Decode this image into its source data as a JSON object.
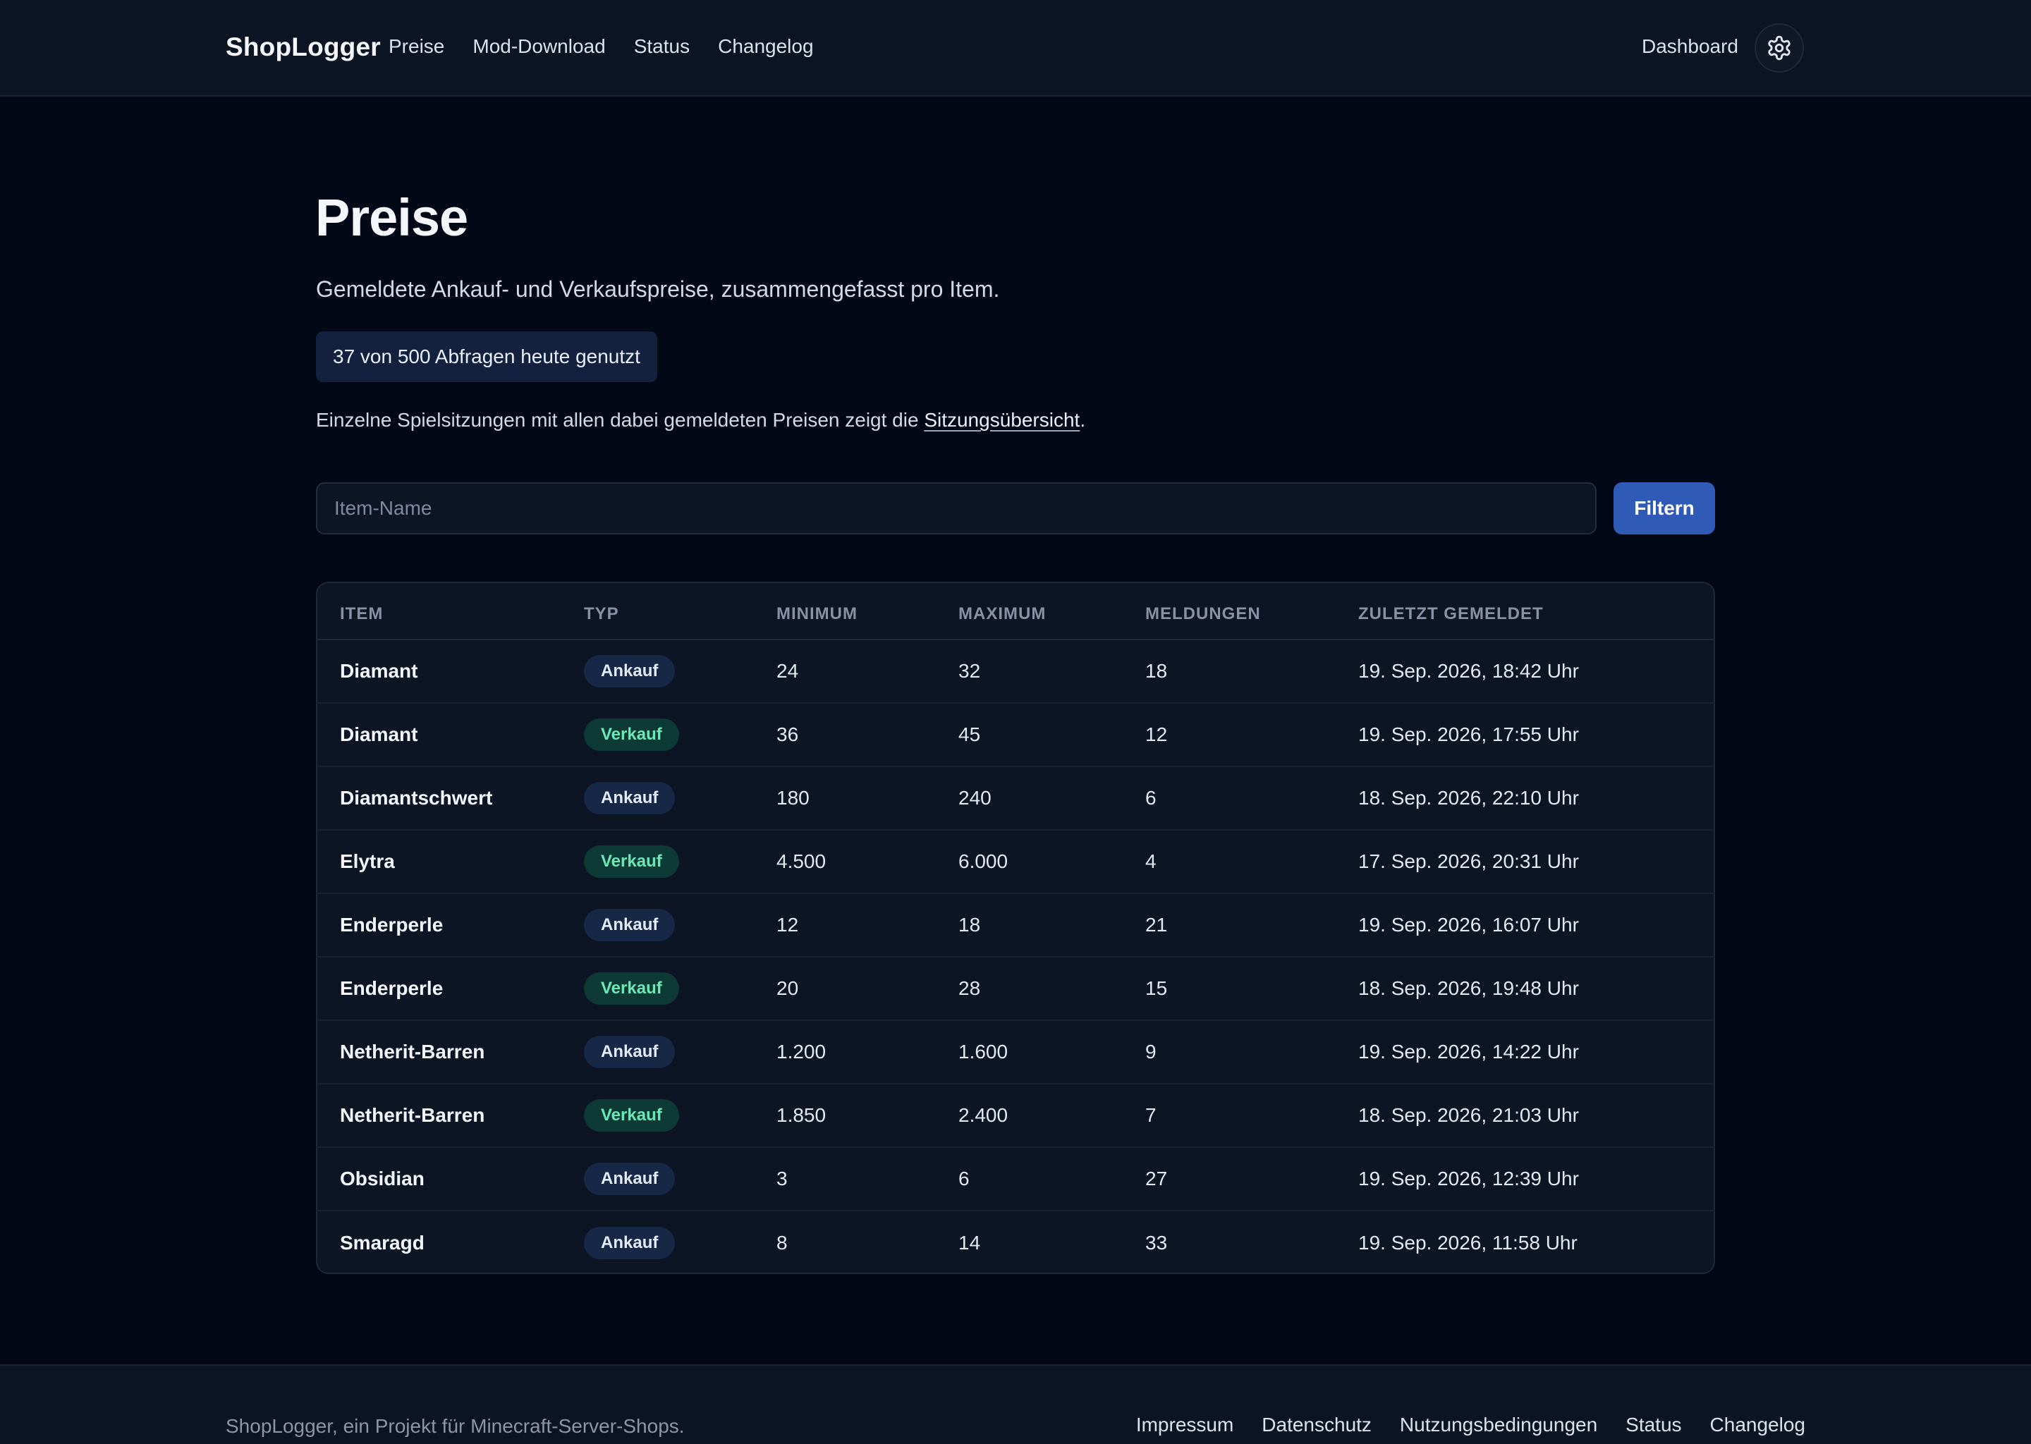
{
  "header": {
    "brand": "ShopLogger",
    "nav": [
      "Preise",
      "Mod-Download",
      "Status",
      "Changelog"
    ],
    "dashboard_label": "Dashboard",
    "settings_icon": "gear-icon"
  },
  "main": {
    "title": "Preise",
    "subtitle": "Gemeldete Ankauf- und Verkaufspreise, zusammengefasst pro Item.",
    "quota": "37 von 500 Abfragen heute genutzt",
    "info_prefix": "Einzelne Spielsitzungen mit allen dabei gemeldeten Preisen zeigt die ",
    "info_link": "Sitzungsübersicht",
    "info_suffix": ".",
    "search_placeholder": "Item-Name",
    "filter_label": "Filtern"
  },
  "table": {
    "columns": [
      "Item",
      "Typ",
      "Minimum",
      "Maximum",
      "Meldungen",
      "Zuletzt gemeldet"
    ],
    "rows": [
      {
        "item": "Diamant",
        "typ": "Ankauf",
        "min": "24",
        "max": "32",
        "meldungen": "18",
        "zuletzt": "19. Sep. 2026, 18:42 Uhr"
      },
      {
        "item": "Diamant",
        "typ": "Verkauf",
        "min": "36",
        "max": "45",
        "meldungen": "12",
        "zuletzt": "19. Sep. 2026, 17:55 Uhr"
      },
      {
        "item": "Diamantschwert",
        "typ": "Ankauf",
        "min": "180",
        "max": "240",
        "meldungen": "6",
        "zuletzt": "18. Sep. 2026, 22:10 Uhr"
      },
      {
        "item": "Elytra",
        "typ": "Verkauf",
        "min": "4.500",
        "max": "6.000",
        "meldungen": "4",
        "zuletzt": "17. Sep. 2026, 20:31 Uhr"
      },
      {
        "item": "Enderperle",
        "typ": "Ankauf",
        "min": "12",
        "max": "18",
        "meldungen": "21",
        "zuletzt": "19. Sep. 2026, 16:07 Uhr"
      },
      {
        "item": "Enderperle",
        "typ": "Verkauf",
        "min": "20",
        "max": "28",
        "meldungen": "15",
        "zuletzt": "18. Sep. 2026, 19:48 Uhr"
      },
      {
        "item": "Netherit-Barren",
        "typ": "Ankauf",
        "min": "1.200",
        "max": "1.600",
        "meldungen": "9",
        "zuletzt": "19. Sep. 2026, 14:22 Uhr"
      },
      {
        "item": "Netherit-Barren",
        "typ": "Verkauf",
        "min": "1.850",
        "max": "2.400",
        "meldungen": "7",
        "zuletzt": "18. Sep. 2026, 21:03 Uhr"
      },
      {
        "item": "Obsidian",
        "typ": "Ankauf",
        "min": "3",
        "max": "6",
        "meldungen": "27",
        "zuletzt": "19. Sep. 2026, 12:39 Uhr"
      },
      {
        "item": "Smaragd",
        "typ": "Ankauf",
        "min": "8",
        "max": "14",
        "meldungen": "33",
        "zuletzt": "19. Sep. 2026, 11:58 Uhr"
      }
    ]
  },
  "footer": {
    "text": "ShopLogger, ein Projekt für Minecraft-Server-Shops.",
    "links": [
      "Impressum",
      "Datenschutz",
      "Nutzungsbedingungen",
      "Status",
      "Changelog"
    ]
  },
  "colors": {
    "background": "#030817",
    "surface": "#0c1322",
    "accent": "#2f5bb7",
    "ankauf_badge": "#172746",
    "verkauf_badge": "#0d3a34",
    "verkauf_text": "#6ee7b7"
  }
}
